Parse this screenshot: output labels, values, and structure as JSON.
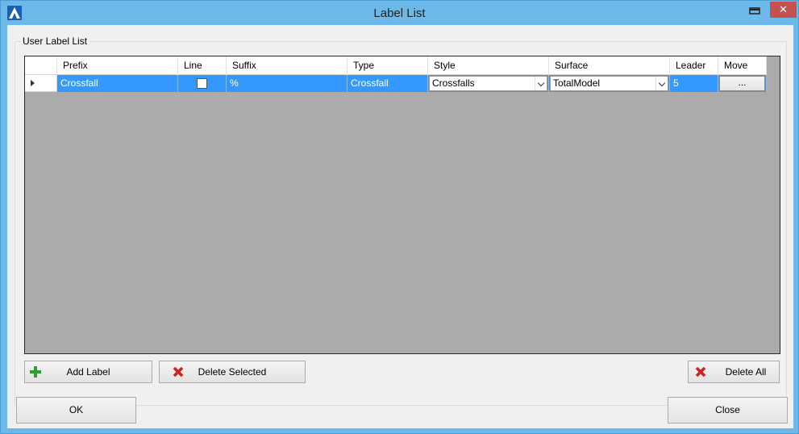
{
  "window": {
    "title": "Label List"
  },
  "group": {
    "label": "User Label List"
  },
  "grid": {
    "columns": [
      "Prefix",
      "Line",
      "Suffix",
      "Type",
      "Style",
      "Surface",
      "Leader",
      "Move"
    ],
    "rows": [
      {
        "prefix": "Crossfall",
        "line_checked": false,
        "suffix": "%",
        "type": "Crossfall",
        "style": "Crossfalls",
        "surface": "TotalModel",
        "leader": "5",
        "move": "..."
      }
    ]
  },
  "buttons": {
    "add_label": "Add Label",
    "delete_selected": "Delete Selected",
    "delete_all": "Delete All",
    "ok": "OK",
    "close": "Close"
  },
  "icons": {
    "app": "app-logo-icon",
    "add": "plus-icon",
    "delete": "red-x-icon"
  },
  "colors": {
    "titlebar": "#6cb8e8",
    "selection": "#3399ff",
    "close_button": "#c75050",
    "grid_background": "#ababab"
  }
}
